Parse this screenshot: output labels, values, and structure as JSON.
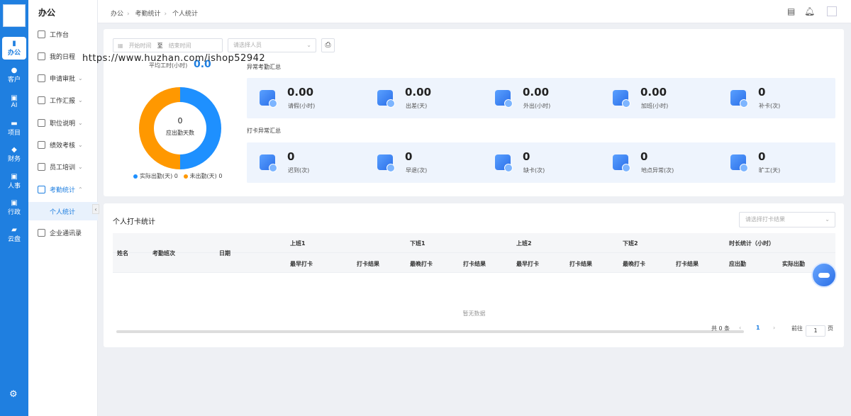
{
  "rail": {
    "items": [
      {
        "label": "办公",
        "icon": "office-icon",
        "active": true
      },
      {
        "label": "客户",
        "icon": "customer-icon"
      },
      {
        "label": "AI",
        "icon": "ai-icon"
      },
      {
        "label": "项目",
        "icon": "project-icon"
      },
      {
        "label": "财务",
        "icon": "finance-icon"
      },
      {
        "label": "人事",
        "icon": "hr-icon"
      },
      {
        "label": "行政",
        "icon": "admin-icon"
      },
      {
        "label": "云盘",
        "icon": "cloud-disk-icon"
      }
    ],
    "settings_icon": "gear-icon"
  },
  "sidebar": {
    "title": "办公",
    "items": [
      {
        "label": "工作台"
      },
      {
        "label": "我的日程"
      },
      {
        "label": "申请审批"
      },
      {
        "label": "工作汇报"
      },
      {
        "label": "职位说明"
      },
      {
        "label": "绩效考核"
      },
      {
        "label": "员工培训"
      },
      {
        "label": "考勤统计"
      },
      {
        "label": "个人统计"
      },
      {
        "label": "企业通讯录"
      }
    ]
  },
  "header": {
    "breadcrumb": [
      "办公",
      "考勤统计",
      "个人统计"
    ]
  },
  "filters": {
    "start_placeholder": "开始时间",
    "range_sep": "至",
    "end_placeholder": "结束时间",
    "person_placeholder": "请选择人员"
  },
  "overview": {
    "avg_label": "平均工时(小时)",
    "avg_value": "0.0",
    "watermark_url": "https://www.huzhan.com/ishop52942",
    "donut_value": "0",
    "donut_label": "应出勤天数",
    "actual": {
      "label": "实际出勤(天)",
      "value": "0",
      "color": "#1e90ff"
    },
    "absent": {
      "label": "未出勤(天)",
      "value": "0",
      "color": "#ff9800"
    }
  },
  "abnormal_summary": {
    "title": "异常考勤汇总",
    "items": [
      {
        "value": "0.00",
        "label": "请假(小时)"
      },
      {
        "value": "0.00",
        "label": "出差(天)"
      },
      {
        "value": "0.00",
        "label": "外出(小时)"
      },
      {
        "value": "0.00",
        "label": "加班(小时)"
      },
      {
        "value": "0",
        "label": "补卡(次)"
      }
    ]
  },
  "clock_summary": {
    "title": "打卡异常汇总",
    "items": [
      {
        "value": "0",
        "label": "迟到(次)"
      },
      {
        "value": "0",
        "label": "早退(次)"
      },
      {
        "value": "0",
        "label": "缺卡(次)"
      },
      {
        "value": "0",
        "label": "地点异常(次)"
      },
      {
        "value": "0",
        "label": "旷工(天)"
      }
    ]
  },
  "clock_table": {
    "title": "个人打卡统计",
    "result_placeholder": "请选择打卡结果",
    "headers": {
      "name": "姓名",
      "shift": "考勤班次",
      "date": "日期",
      "groups": [
        "上班1",
        "下班1",
        "上班2",
        "下班2",
        "时长统计（小时）"
      ],
      "sub": [
        "最早打卡",
        "打卡结果",
        "最晚打卡",
        "打卡结果",
        "最早打卡",
        "打卡结果",
        "最晚打卡",
        "打卡结果",
        "应出勤",
        "实际出勤"
      ]
    },
    "empty_text": "暂无数据"
  },
  "pagination": {
    "total": "共 0 条",
    "current": "1",
    "goto_label": "前往",
    "goto_value": "1",
    "page_suffix": "页"
  }
}
